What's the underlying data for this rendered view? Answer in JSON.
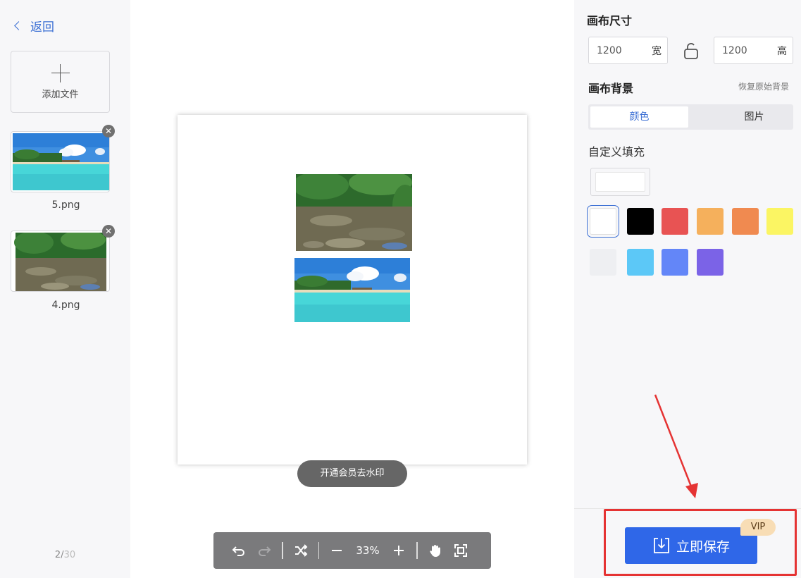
{
  "sidebar": {
    "back_label": "返回",
    "add_file_label": "添加文件",
    "files": [
      {
        "name": "5.png",
        "image": "beach-seascape"
      },
      {
        "name": "4.png",
        "image": "forest-stream"
      }
    ],
    "counter_current": "2",
    "counter_separator": "/",
    "counter_total": "30"
  },
  "canvas": {
    "images": [
      "forest-stream",
      "beach-seascape"
    ],
    "watermark_button": "开通会员去水印"
  },
  "toolbar": {
    "zoom": "33%",
    "icons": [
      "undo-icon",
      "redo-icon",
      "shuffle-icon",
      "zoom-out-icon",
      "zoom-in-icon",
      "hand-icon",
      "fit-screen-icon"
    ]
  },
  "panel": {
    "canvas_size_title": "画布尺寸",
    "width_value": "1200",
    "width_unit": "宽",
    "height_value": "1200",
    "height_unit": "高",
    "background_title": "画布背景",
    "restore_label": "恢复原始背景",
    "tabs": {
      "color": "颜色",
      "image": "图片"
    },
    "custom_fill_label": "自定义填充",
    "swatches": [
      "#ffffff",
      "#000000",
      "#e85353",
      "#f5b05c",
      "#f08a50",
      "#fbf563",
      "#eeeff2",
      "#5cc8f7",
      "#6386f8",
      "#7b63e7"
    ],
    "selected_swatch": "#ffffff",
    "save_label": "立即保存",
    "vip_label": "VIP",
    "accent_color": "#2f67e8",
    "annotation_color": "#e53333"
  }
}
